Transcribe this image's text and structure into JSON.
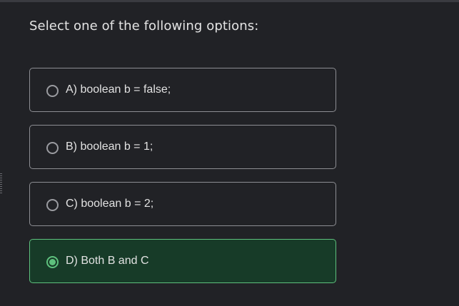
{
  "question": "Select one of the following options:",
  "options": [
    {
      "label": "A) boolean b = false;",
      "selected": false
    },
    {
      "label": "B) boolean b = 1;",
      "selected": false
    },
    {
      "label": "C) boolean b = 2;",
      "selected": false
    },
    {
      "label": "D) Both B and C",
      "selected": true
    }
  ],
  "colors": {
    "background": "#212226",
    "selected_background": "#173b28",
    "accent": "#5ec07d",
    "border": "#8d8e93"
  }
}
